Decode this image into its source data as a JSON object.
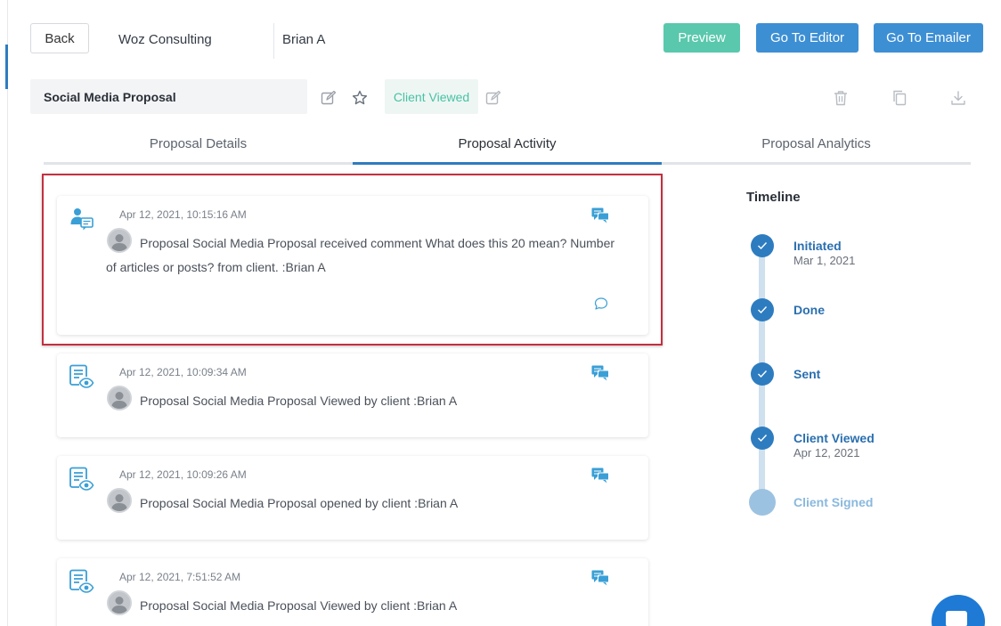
{
  "header": {
    "back_label": "Back",
    "company": "Woz Consulting",
    "client": "Brian A",
    "preview_label": "Preview",
    "editor_label": "Go To Editor",
    "emailer_label": "Go To Emailer"
  },
  "proposal": {
    "title": "Social Media Proposal",
    "status": "Client Viewed"
  },
  "tabs": [
    {
      "label": "Proposal Details"
    },
    {
      "label": "Proposal Activity",
      "active": true
    },
    {
      "label": "Proposal Analytics"
    }
  ],
  "activity": [
    {
      "type": "comment",
      "timestamp": "Apr 12, 2021, 10:15:16 AM",
      "message": "Proposal Social Media Proposal received comment What does this 20 mean? Number of articles or posts? from client. :Brian A"
    },
    {
      "type": "viewed",
      "timestamp": "Apr 12, 2021, 10:09:34 AM",
      "message": "Proposal Social Media Proposal Viewed by client :Brian A"
    },
    {
      "type": "viewed",
      "timestamp": "Apr 12, 2021, 10:09:26 AM",
      "message": "Proposal Social Media Proposal opened by client :Brian A"
    },
    {
      "type": "viewed",
      "timestamp": "Apr 12, 2021, 7:51:52 AM",
      "message": "Proposal Social Media Proposal Viewed by client :Brian A"
    }
  ],
  "timeline": {
    "title": "Timeline",
    "steps": [
      {
        "label": "Initiated",
        "date": "Mar 1, 2021",
        "done": true
      },
      {
        "label": "Done",
        "date": "",
        "done": true
      },
      {
        "label": "Sent",
        "date": "",
        "done": true
      },
      {
        "label": "Client Viewed",
        "date": "Apr 12, 2021",
        "done": true
      },
      {
        "label": "Client Signed",
        "date": "",
        "done": false
      }
    ]
  },
  "colors": {
    "primary": "#3d8fd4",
    "preview": "#5ac8ad",
    "status": "#48c2a5",
    "highlight": "#c3303f"
  },
  "icons": {
    "edit": "pencil-square-icon",
    "star": "star-icon",
    "delete": "trash-icon",
    "copy": "copy-icon",
    "download": "download-icon",
    "chat": "chat-bubbles-icon",
    "reply": "reply-bubble-icon",
    "comment_type": "user-comment-icon",
    "viewed_type": "document-eye-icon"
  }
}
